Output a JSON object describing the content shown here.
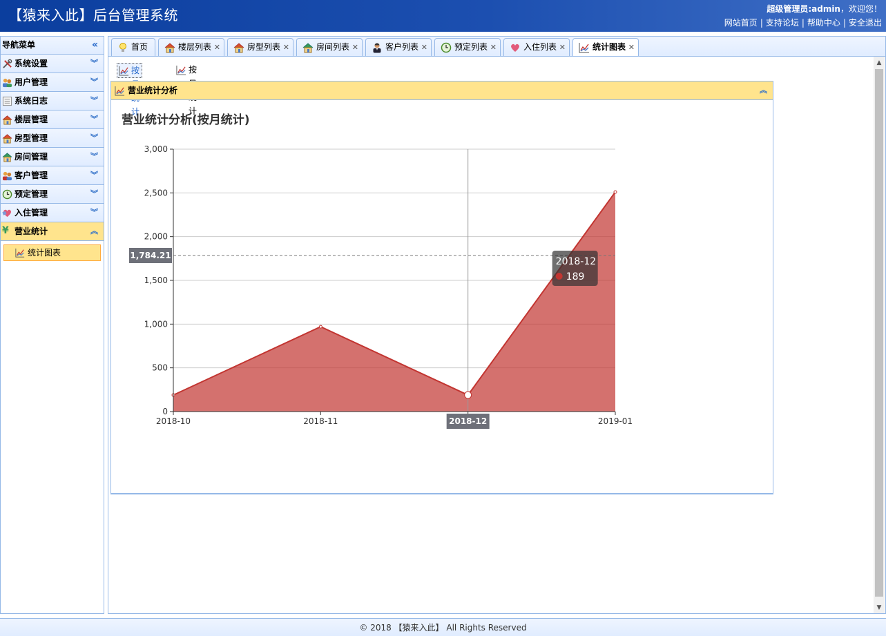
{
  "header": {
    "title": "【猿来入此】后台管理系统",
    "welcome_role": "超级管理员:admin",
    "welcome_suffix": "，欢迎您！",
    "links": [
      "网站首页",
      "支持论坛",
      "帮助中心",
      "安全退出"
    ]
  },
  "sidebar": {
    "title": "导航菜单",
    "items": [
      {
        "label": "系统设置",
        "icon": "tools-icon"
      },
      {
        "label": "用户管理",
        "icon": "users-icon"
      },
      {
        "label": "系统日志",
        "icon": "log-icon"
      },
      {
        "label": "楼层管理",
        "icon": "house-icon"
      },
      {
        "label": "房型管理",
        "icon": "house-icon"
      },
      {
        "label": "房间管理",
        "icon": "house-icon"
      },
      {
        "label": "客户管理",
        "icon": "users-icon"
      },
      {
        "label": "预定管理",
        "icon": "clock-icon"
      },
      {
        "label": "入住管理",
        "icon": "heart-icon"
      },
      {
        "label": "营业统计",
        "icon": "yen-icon"
      }
    ],
    "sub_item": "统计图表"
  },
  "tabs": [
    {
      "label": "首页",
      "icon": "bulb-icon",
      "closable": false
    },
    {
      "label": "楼层列表",
      "icon": "house-icon",
      "closable": true
    },
    {
      "label": "房型列表",
      "icon": "house-icon",
      "closable": true
    },
    {
      "label": "房间列表",
      "icon": "house-icon",
      "closable": true
    },
    {
      "label": "客户列表",
      "icon": "person-icon",
      "closable": true
    },
    {
      "label": "预定列表",
      "icon": "clock-icon",
      "closable": true
    },
    {
      "label": "入住列表",
      "icon": "heart-icon",
      "closable": true
    },
    {
      "label": "统计图表",
      "icon": "chart-icon",
      "closable": true
    }
  ],
  "toolbar": {
    "monthly": "按月统计",
    "daily": "按日统计"
  },
  "panel": {
    "title": "营业统计分析"
  },
  "chart_data": {
    "type": "area",
    "title": "营业统计分析(按月统计)",
    "categories": [
      "2018-10",
      "2018-11",
      "2018-12",
      "2019-01"
    ],
    "values": [
      189,
      970,
      189,
      2510
    ],
    "ylim": [
      0,
      3000
    ],
    "yticks": [
      "0",
      "500",
      "1,000",
      "1,500",
      "2,000",
      "2,500",
      "3,000"
    ],
    "color": "#c23531",
    "grid": true,
    "tooltip": {
      "category": "2018-12",
      "value": "189"
    },
    "crosshair_y_label": "1,784.21",
    "crosshair_x_label": "2018-12"
  },
  "footer": {
    "text": "© 2018 【猿来入此】 All Rights Reserved"
  }
}
